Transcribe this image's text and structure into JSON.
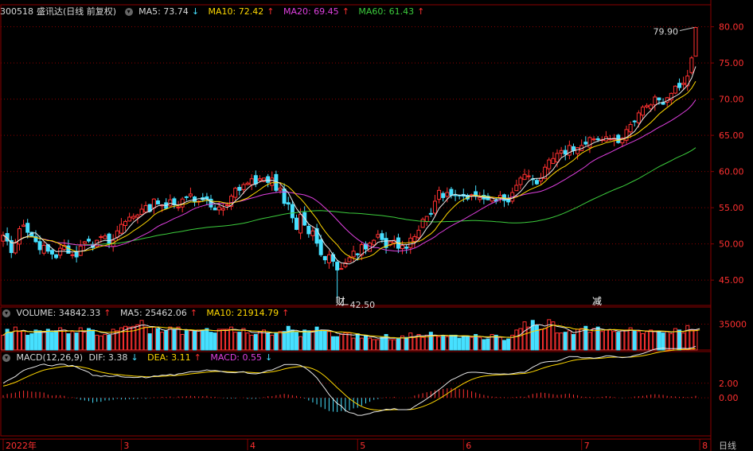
{
  "price_header": {
    "code": "300518",
    "name": "盛讯达(日线 前复权)",
    "ma5": "MA5: 73.74",
    "ma10": "MA10: 72.42",
    "ma20": "MA20: 69.45",
    "ma60": "MA60: 61.43"
  },
  "volume_header": {
    "volume": "VOLUME: 34842.33",
    "ma5": "MA5: 25462.06",
    "ma10": "MA10: 21914.79"
  },
  "macd_header": {
    "title": "MACD(12,26,9)",
    "dif": "DIF: 3.38",
    "dea": "DEA: 3.11",
    "macd": "MACD: 0.55"
  },
  "colors": {
    "up": "#ff3030",
    "down": "#46e0ff",
    "ma5": "#e8e8e8",
    "ma10": "#ffd800",
    "ma20": "#e040e0",
    "ma60": "#3ccc3c",
    "grid": "#8b0000"
  },
  "icons": {
    "panel_control": "circle-chevron-icon",
    "arrow_up": "up-arrow-icon",
    "arrow_down": "down-arrow-icon"
  },
  "chart_data": {
    "type": "candlestick",
    "price_axis": {
      "ticks": [
        "45.00",
        "50.00",
        "55.00",
        "60.00",
        "65.00",
        "70.00",
        "75.00",
        "80.00"
      ],
      "range": [
        41.5,
        81.5
      ]
    },
    "volume_axis": {
      "ticks": [
        "35000"
      ],
      "range": [
        0,
        43000
      ]
    },
    "macd_axis": {
      "ticks": [
        "0.00",
        "2.00"
      ],
      "range": [
        -5.2,
        4.8
      ]
    },
    "x_labels": [
      "2022年",
      "3",
      "4",
      "5",
      "6",
      "7",
      "8"
    ],
    "x_label_index": [
      0,
      29,
      60,
      87,
      113,
      142,
      171
    ],
    "high_annotation": {
      "label": "79.90",
      "value": 79.9
    },
    "low_annotation": {
      "label": "42.50",
      "value": 42.5
    },
    "markers": [
      {
        "label": "财",
        "index": 82
      },
      {
        "label": "减",
        "index": 145
      }
    ],
    "period_label": "日线",
    "closes": [
      51.2,
      50.4,
      48.8,
      50.2,
      52.1,
      52.6,
      51.6,
      51.0,
      50.3,
      49.2,
      49.8,
      49.0,
      48.6,
      48.1,
      49.4,
      49.8,
      48.7,
      48.5,
      48.2,
      49.7,
      50.3,
      50.4,
      49.5,
      50.5,
      51.0,
      51.1,
      50.0,
      50.5,
      51.8,
      52.7,
      53.1,
      53.7,
      53.8,
      54.0,
      54.8,
      55.3,
      54.5,
      56.2,
      55.5,
      55.4,
      54.9,
      56.1,
      55.4,
      55.1,
      56.2,
      56.4,
      56.9,
      55.9,
      55.9,
      56.1,
      56.2,
      55.1,
      54.7,
      55.1,
      54.9,
      55.4,
      56.6,
      57.7,
      57.4,
      58.2,
      58.4,
      59.0,
      58.3,
      59.0,
      59.1,
      58.5,
      59.1,
      57.4,
      57.7,
      55.6,
      55.5,
      53.6,
      52.0,
      54.1,
      52.6,
      51.4,
      51.8,
      50.1,
      48.5,
      47.8,
      48.5,
      47.6,
      46.4,
      46.6,
      47.4,
      48.1,
      49.0,
      48.5,
      49.9,
      49.3,
      50.1,
      50.5,
      51.3,
      50.6,
      49.5,
      50.3,
      50.5,
      49.4,
      49.8,
      49.4,
      50.8,
      51.0,
      51.9,
      53.4,
      53.8,
      54.1,
      55.9,
      57.4,
      56.4,
      57.1,
      56.7,
      56.7,
      56.7,
      56.6,
      56.2,
      56.8,
      56.6,
      56.4,
      56.2,
      56.1,
      56.4,
      55.9,
      56.7,
      56.0,
      55.8,
      57.1,
      58.1,
      59.1,
      59.6,
      59.4,
      58.9,
      58.3,
      59.1,
      60.6,
      61.6,
      61.8,
      62.5,
      62.9,
      62.4,
      63.6,
      62.9,
      63.3,
      63.6,
      63.8,
      64.7,
      64.5,
      64.4,
      64.4,
      64.8,
      64.5,
      64.6,
      64.0,
      64.6,
      65.8,
      66.5,
      66.9,
      68.1,
      68.9,
      69.1,
      69.2,
      70.3,
      69.9,
      69.3,
      70.2,
      70.8,
      71.8,
      71.6,
      72.2,
      73.2,
      75.7,
      79.9
    ],
    "volumes": [
      20000,
      28000,
      24000,
      31000,
      25000,
      26000,
      20000,
      22000,
      27000,
      26000,
      24000,
      28000,
      24000,
      26000,
      30000,
      27000,
      22000,
      25000,
      23000,
      30000,
      24000,
      29000,
      27000,
      20000,
      19000,
      21000,
      20000,
      28000,
      26000,
      30000,
      32000,
      31000,
      32000,
      34000,
      40000,
      31000,
      22000,
      31000,
      29000,
      24000,
      26000,
      31000,
      28000,
      31000,
      21000,
      27000,
      26000,
      26000,
      27000,
      27000,
      29000,
      24000,
      23000,
      28000,
      28000,
      28000,
      31000,
      24000,
      24000,
      29000,
      23000,
      20000,
      21000,
      25000,
      27000,
      23000,
      20000,
      23000,
      25000,
      25000,
      32000,
      27000,
      24000,
      18000,
      27000,
      26000,
      26000,
      31000,
      26000,
      26000,
      25000,
      18000,
      18000,
      21000,
      23000,
      23000,
      16000,
      22000,
      16000,
      20000,
      16000,
      14000,
      14000,
      17000,
      21000,
      14000,
      14000,
      15000,
      19000,
      17000,
      23000,
      17000,
      21000,
      17000,
      20000,
      24000,
      19000,
      18000,
      19000,
      18000,
      20000,
      20000,
      16000,
      19000,
      19000,
      17000,
      21000,
      17000,
      14000,
      15000,
      21000,
      20000,
      17000,
      13000,
      15000,
      20000,
      27000,
      29000,
      38000,
      31000,
      40000,
      33000,
      28000,
      29000,
      41000,
      38000,
      23000,
      23000,
      24000,
      26000,
      21000,
      28000,
      29000,
      32000,
      24000,
      29000,
      31000,
      25000,
      27000,
      27000,
      25000,
      24000,
      26000,
      27000,
      30000,
      26000,
      25000,
      22000,
      25000,
      27000,
      25000,
      25000,
      23000,
      25000,
      22000,
      29000,
      27000,
      23000,
      33000,
      27000,
      27000,
      34842
    ],
    "macd": [
      0.8,
      1.2,
      1.4,
      1.6,
      2.0,
      2.2,
      2.1,
      1.9,
      1.8,
      1.8,
      1.6,
      1.0,
      0.7,
      0.8,
      0.8,
      0.6,
      0.1,
      0.2,
      -0.2,
      -0.6,
      -0.8,
      -1.0,
      -1.5,
      -1.2,
      -1.2,
      -0.8,
      -0.8,
      -0.6,
      -0.3,
      -0.5,
      -0.5,
      -0.4,
      -0.4,
      -0.3,
      -0.1,
      -0.3,
      -0.1,
      0.2,
      0.1,
      0.3,
      0.2,
      0.4,
      0.1,
      0.4,
      0.4,
      0.5,
      0.6,
      0.5,
      0.4,
      0.5,
      0.6,
      0.3,
      0.3,
      0.1,
      -0.1,
      -0.2,
      -0.2,
      -0.2,
      0.0,
      0.1,
      -0.3,
      -0.3,
      -0.3,
      -0.1,
      0.2,
      0.5,
      0.5,
      0.8,
      1.0,
      1.2,
      1.0,
      0.8,
      0.6,
      0.3,
      -0.2,
      -0.8,
      -1.4,
      -2.0,
      -2.8,
      -3.4,
      -4.0,
      -4.2,
      -4.3,
      -4.0,
      -4.2,
      -3.8,
      -3.2,
      -3.0,
      -2.4,
      -1.7,
      -1.2,
      -0.6,
      -0.4,
      -0.1,
      0.2,
      0.1,
      0.3,
      0.0,
      0.0,
      0.0,
      0.1,
      0.7,
      1.1,
      1.4,
      1.7,
      2.0,
      2.3,
      2.5,
      2.7,
      2.9,
      3.0,
      2.8,
      2.7,
      2.6,
      2.4,
      2.0,
      1.6,
      1.2,
      0.9,
      0.6,
      0.4,
      0.3,
      0.2,
      0.2,
      0.1,
      0.2,
      0.3,
      0.4,
      0.3,
      0.8,
      1.2,
      1.4,
      1.6,
      1.5,
      1.3,
      1.1,
      0.9,
      1.0,
      1.2,
      1.3,
      1.0,
      0.8,
      0.4,
      0.3,
      0.3,
      0.1,
      0.2,
      0.3,
      0.5,
      0.4,
      0.2,
      0.0,
      -0.1,
      0.0,
      0.1,
      0.4,
      0.5,
      0.6,
      0.8,
      1.0,
      1.1,
      1.0,
      0.9,
      0.6,
      0.5,
      0.4,
      0.3,
      0.3,
      0.2,
      0.3,
      0.6,
      0.9,
      0.6
    ]
  }
}
